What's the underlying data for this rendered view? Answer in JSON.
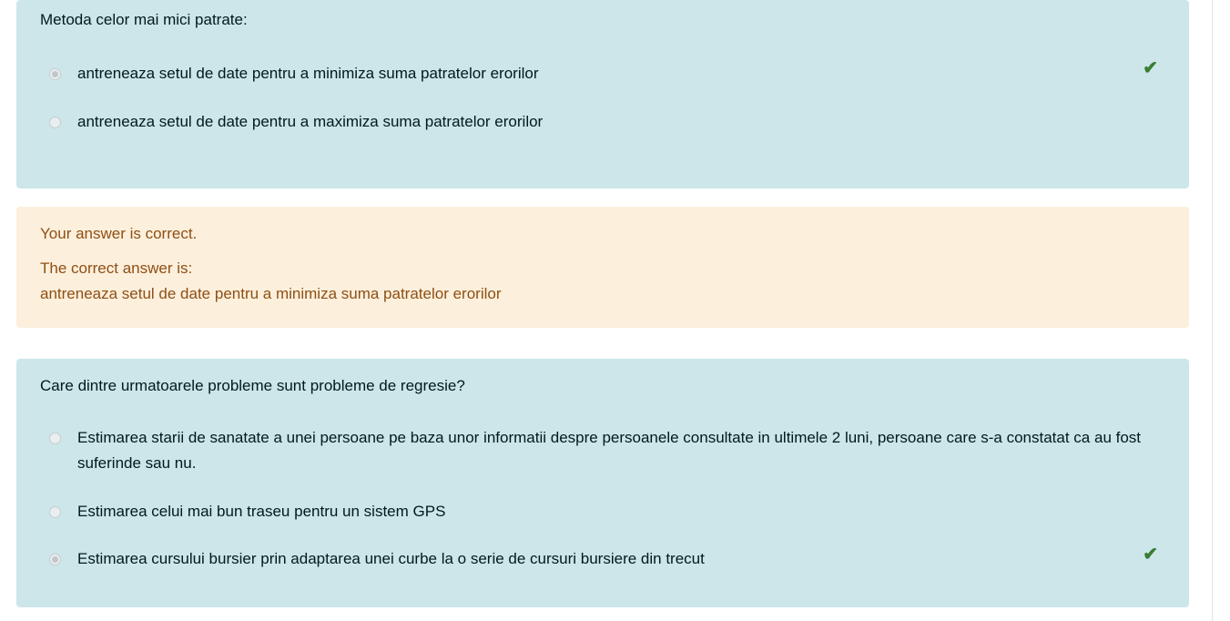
{
  "q1": {
    "text": "Metoda celor mai mici patrate:",
    "options": [
      {
        "label": "antreneaza setul de date pentru a minimiza suma patratelor erorilor",
        "selected": true,
        "correct": true
      },
      {
        "label": "antreneaza setul de date pentru a maximiza suma patratelor erorilor",
        "selected": false
      }
    ]
  },
  "feedback": {
    "status": "Your answer is correct.",
    "correct_label": "The correct answer is:",
    "correct_answer": "antreneaza setul de date pentru a minimiza suma patratelor erorilor"
  },
  "q2": {
    "text": "Care dintre urmatoarele probleme sunt probleme de regresie?",
    "options": [
      {
        "label": "Estimarea starii de sanatate a unei persoane pe baza unor informatii despre persoanele consultate in ultimele 2 luni, persoane care s-a constatat ca au fost suferinde sau nu.",
        "selected": false
      },
      {
        "label": "Estimarea celui mai bun traseu pentru un sistem GPS",
        "selected": false
      },
      {
        "label": "Estimarea cursului bursier prin adaptarea unei curbe la o serie de cursuri bursiere din trecut",
        "selected": true,
        "correct": true
      }
    ]
  },
  "icons": {
    "check": "✔"
  },
  "colors": {
    "question_bg": "#cce6ea",
    "feedback_bg": "#fcefdc",
    "check": "#3a7d32"
  }
}
